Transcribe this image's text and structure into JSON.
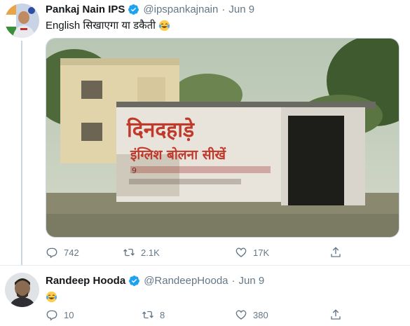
{
  "tweets": [
    {
      "author_name": "Pankaj Nain IPS",
      "handle": "@ipspankajnain",
      "separator": "·",
      "date": "Jun 9",
      "text": "English सिखाएगा या डकैती",
      "emoji_icon": "tears-of-joy-emoji-icon",
      "media": {
        "sign_line_1": "दिनदहाड़े",
        "sign_line_2": "इंग्लिश बोलना सीखें",
        "sign_line_3": "9",
        "sign_line_4": "ॅ"
      },
      "actions": {
        "reply_count": "742",
        "retweet_count": "2.1K",
        "like_count": "17K"
      }
    },
    {
      "author_name": "Randeep Hooda",
      "handle": "@RandeepHooda",
      "separator": "·",
      "date": "Jun 9",
      "text": "",
      "emoji_icon": "tears-of-joy-emoji-icon",
      "actions": {
        "reply_count": "10",
        "retweet_count": "8",
        "like_count": "380"
      }
    }
  ],
  "colors": {
    "verified": "#1da1f2",
    "secondary_text": "#657786",
    "primary_text": "#14171a",
    "thread_line": "#ccd6dd"
  }
}
